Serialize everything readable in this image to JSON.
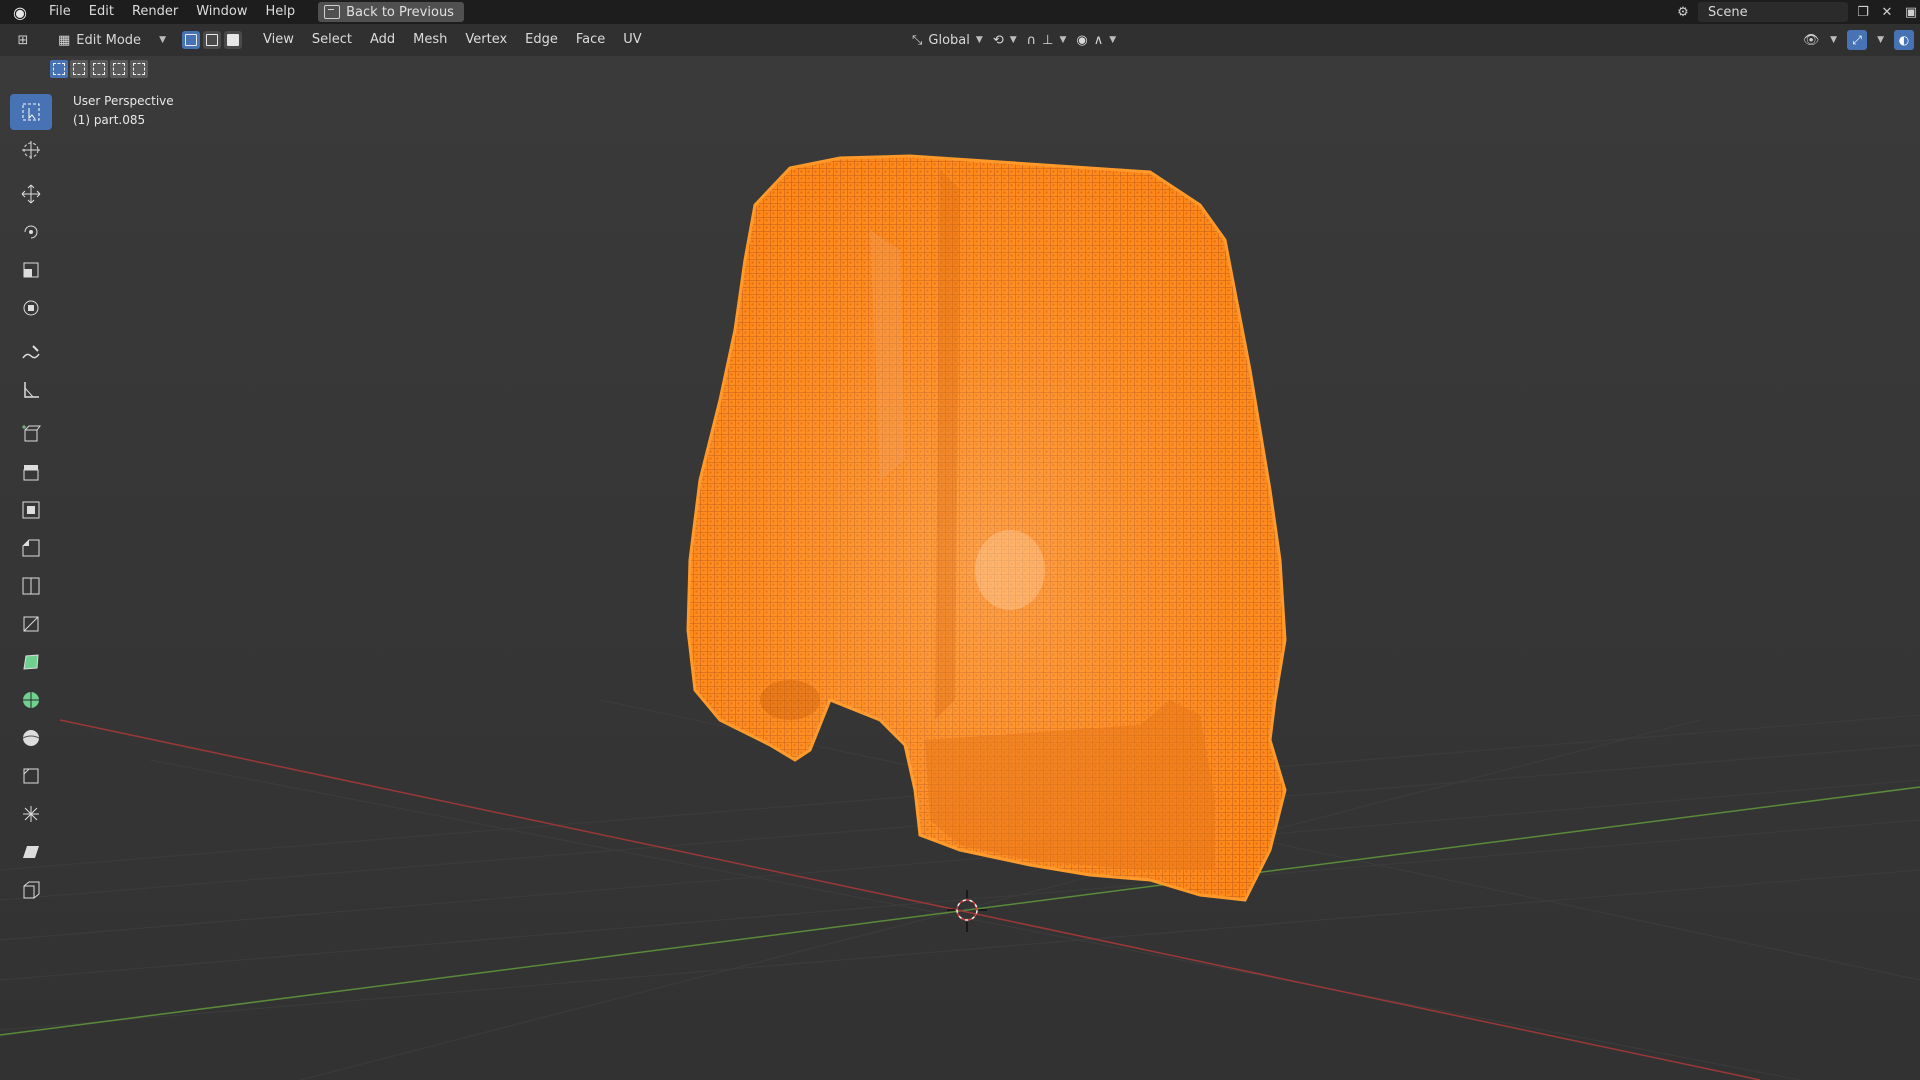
{
  "topbar": {
    "menus": [
      "File",
      "Edit",
      "Render",
      "Window",
      "Help"
    ],
    "back_button": "Back to Previous",
    "scene_name": "Scene"
  },
  "header": {
    "mode": "Edit Mode",
    "menus": [
      "View",
      "Select",
      "Add",
      "Mesh",
      "Vertex",
      "Edge",
      "Face",
      "UV"
    ],
    "transform_orientation": "Global"
  },
  "viewport": {
    "view_name": "User Perspective",
    "object_name": "(1) part.085",
    "mesh_color": "#ff8a1a",
    "background": "#3a3a3a"
  },
  "toolbar": {
    "tools": [
      "select-box",
      "cursor",
      "move",
      "rotate",
      "scale",
      "transform",
      "annotate",
      "measure",
      "add-cube",
      "extrude",
      "inset",
      "bevel",
      "loop-cut",
      "knife",
      "poly-build",
      "spin",
      "smooth",
      "edge-slide",
      "shrink-fatten",
      "shear",
      "rip"
    ],
    "active_tool": "select-box"
  }
}
